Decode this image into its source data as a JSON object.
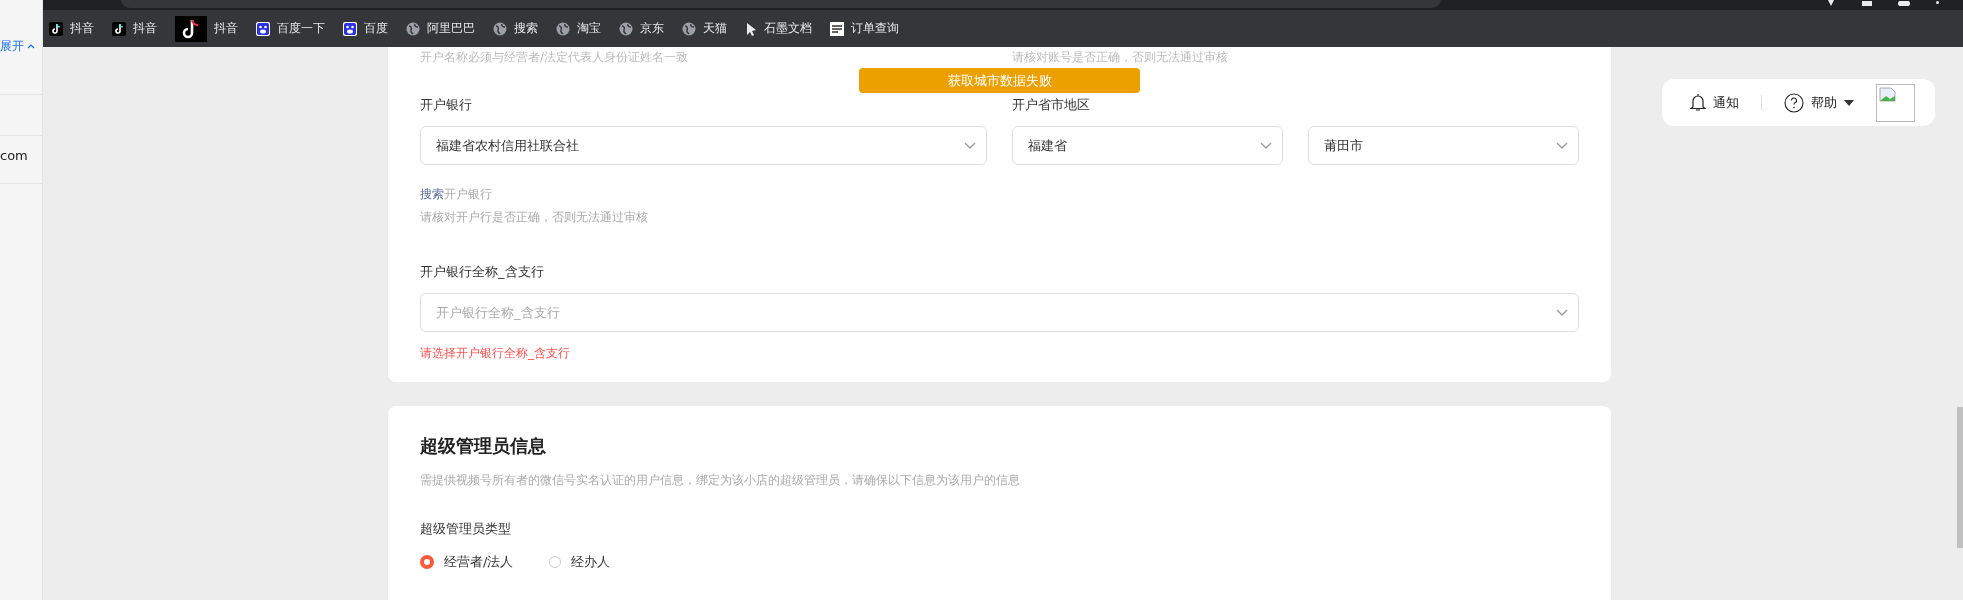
{
  "sidebar": {
    "items": [
      {
        "label": "展开",
        "kind": "toggle"
      },
      {
        "label": "com",
        "kind": "text"
      }
    ]
  },
  "bookmarks": [
    {
      "label": "抖音",
      "kind": "tiktok"
    },
    {
      "label": "抖音",
      "kind": "tiktok"
    },
    {
      "label": "抖音",
      "kind": "tiktok-large"
    },
    {
      "label": "百度一下",
      "kind": "baidu"
    },
    {
      "label": "百度",
      "kind": "baidu"
    },
    {
      "label": "阿里巴巴",
      "kind": "globe"
    },
    {
      "label": "搜索",
      "kind": "globe"
    },
    {
      "label": "淘宝",
      "kind": "globe"
    },
    {
      "label": "京东",
      "kind": "globe"
    },
    {
      "label": "天猫",
      "kind": "globe"
    },
    {
      "label": "石墨文档",
      "kind": "cursor"
    },
    {
      "label": "订单查询",
      "kind": "doc"
    }
  ],
  "toast": "获取城市数据失败",
  "header_tools": {
    "notify": "通知",
    "help": "帮助"
  },
  "bank_card": {
    "notes": [
      "开户名称必须与经营者/法定代表人身份证姓名一致",
      "请核对账号是否正确，否则无法通过审核"
    ],
    "bank_label": "开户银行",
    "bank_select": {
      "value": "福建省农村信用社联合社"
    },
    "region_label": "开户省市地区",
    "province_select": {
      "value": "福建省"
    },
    "city_select": {
      "value": "莆田市"
    },
    "search_link": "搜索",
    "search_text": "开户银行",
    "hint": "请核对开户行是否正确，否则无法通过审核",
    "branch_label": "开户银行全称_含支行",
    "branch_select": {
      "placeholder": "开户银行全称_含支行"
    },
    "error": "请选择开户银行全称_含支行"
  },
  "admin_card": {
    "title": "超级管理员信息",
    "description": "需提供视频号所有者的微信号实名认证的用户信息，绑定为该小店的超级管理员，请确保以下信息为该用户的信息",
    "type_label": "超级管理员类型",
    "options": [
      {
        "label": "经营者/法人",
        "selected": true
      },
      {
        "label": "经办人",
        "selected": false
      }
    ]
  }
}
